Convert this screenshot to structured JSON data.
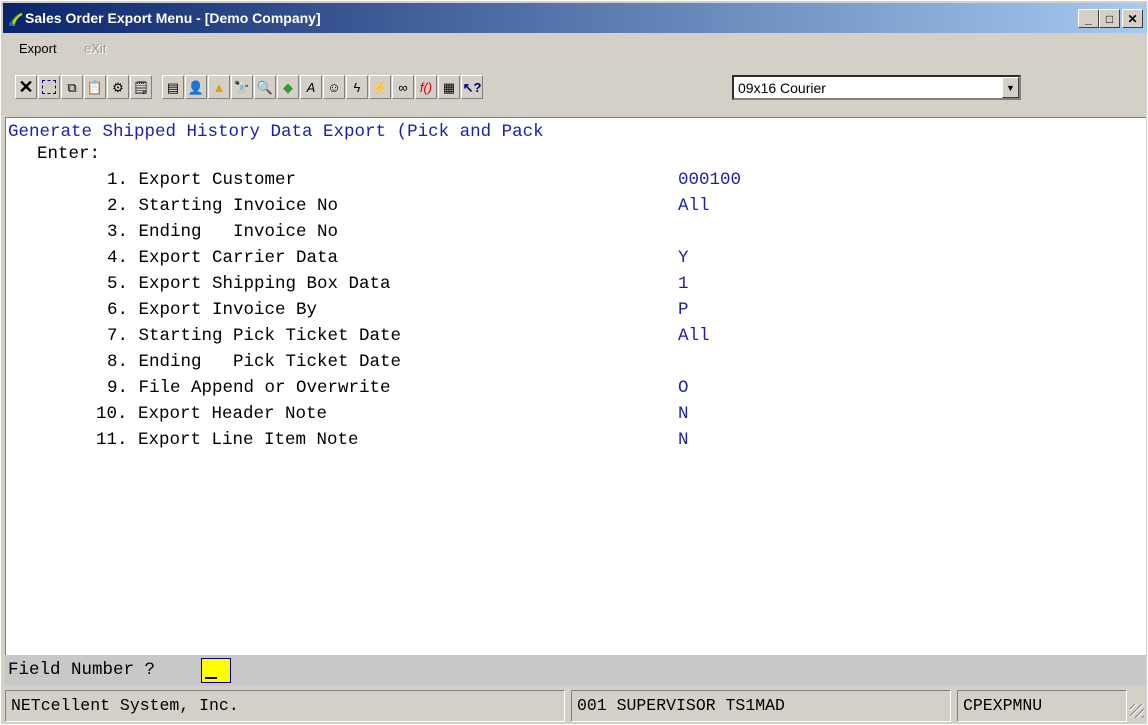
{
  "window": {
    "title": "Sales Order Export Menu - [Demo Company]"
  },
  "menu": [
    {
      "label": "Export",
      "enabled": true
    },
    {
      "label": "eXit",
      "enabled": false
    }
  ],
  "toolbar": {
    "icons": [
      "close-x-icon",
      "select-icon",
      "copy-icon",
      "paste-icon",
      "gear-icon",
      "properties-icon",
      "document-icon",
      "user-icon",
      "alert-icon",
      "binoculars-icon",
      "zoom-icon",
      "globe-icon",
      "pen-icon",
      "person-icon",
      "lightning-icon",
      "lightning-doc-icon",
      "link-icon",
      "function-icon",
      "calculator-icon",
      "help-pointer-icon"
    ],
    "font_select": "09x16 Courier"
  },
  "form": {
    "heading": "Generate Shipped History Data Export (Pick and Pack",
    "enter_label": "Enter:",
    "fields": [
      {
        "label": "1. Export Customer",
        "value": "000100"
      },
      {
        "label": "2. Starting Invoice No",
        "value": "All"
      },
      {
        "label": "3. Ending   Invoice No",
        "value": ""
      },
      {
        "label": "4. Export Carrier Data",
        "value": "Y"
      },
      {
        "label": "5. Export Shipping Box Data",
        "value": "1"
      },
      {
        "label": "6. Export Invoice By",
        "value": "P"
      },
      {
        "label": "7. Starting Pick Ticket Date",
        "value": "All"
      },
      {
        "label": "8. Ending   Pick Ticket Date",
        "value": ""
      },
      {
        "label": "9. File Append or Overwrite",
        "value": "O"
      },
      {
        "label": "10. Export Header Note",
        "value": "N"
      },
      {
        "label": "11. Export Line Item Note",
        "value": "N"
      }
    ]
  },
  "prompt": {
    "label": "Field Number ?"
  },
  "status": {
    "company": "NETcellent System, Inc.",
    "user": "001 SUPERVISOR TS1MAD",
    "program": "CPEXPMNU"
  }
}
